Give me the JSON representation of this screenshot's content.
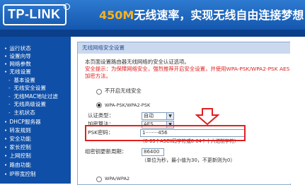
{
  "header": {
    "logo": "TP-LINK",
    "slogan_speed": "450M",
    "slogan_rest": "无线速率，实现无线自由连接梦想"
  },
  "sidebar": {
    "items": [
      {
        "bullet": "•",
        "label": "运行状态"
      },
      {
        "bullet": "•",
        "label": "设置向导"
      },
      {
        "bullet": "•",
        "label": "网络参数"
      },
      {
        "bullet": "•",
        "label": "无线设置"
      },
      {
        "bullet": "-",
        "label": "基本设置"
      },
      {
        "bullet": "-",
        "label": "无线安全设置"
      },
      {
        "bullet": "-",
        "label": "无线MAC地址过滤"
      },
      {
        "bullet": "-",
        "label": "无线高级设置"
      },
      {
        "bullet": "-",
        "label": "主机状态"
      },
      {
        "bullet": "•",
        "label": "DHCP服务器"
      },
      {
        "bullet": "•",
        "label": "转发规则"
      },
      {
        "bullet": "•",
        "label": "安全功能"
      },
      {
        "bullet": "•",
        "label": "家长控制"
      },
      {
        "bullet": "•",
        "label": "上网控制"
      },
      {
        "bullet": "•",
        "label": "路由功能"
      },
      {
        "bullet": "•",
        "label": "IP带宽控制"
      }
    ]
  },
  "panel": {
    "title": "无线网络安全设置",
    "intro": "本页面设置路由器无线网络的安全认证选项。",
    "warning_line1": "安全提示：为保障网络安全，强烈推荐开启安全设置，并使用WPA-PSK/WPA2-PSK AES",
    "warning_line2": "加密方法。",
    "no_security_label": "不开启无线安全",
    "wpa_psk_label": "WPA-PSK/WPA2-PSK",
    "auth_type_label": "认证类型：",
    "auth_type_value": "自动",
    "encryption_label": "加密算法：",
    "encryption_value": "AES",
    "psk_label": "PSK密码：",
    "psk_value": "1········456",
    "psk_hint": "（8-63个ASCII码字符或8-64个十六进制字符）",
    "group_key_label": "组密钥更新周期：",
    "group_key_value": "86400",
    "group_key_hint": "（单位为秒，最小值为30，不更新则为0）",
    "wpa_enterprise_label": "WPA/WPA2"
  },
  "colors": {
    "sidebar_bg": "#0f4fa7",
    "header_accent": "#f7b31f",
    "highlight_red": "#e02020"
  }
}
